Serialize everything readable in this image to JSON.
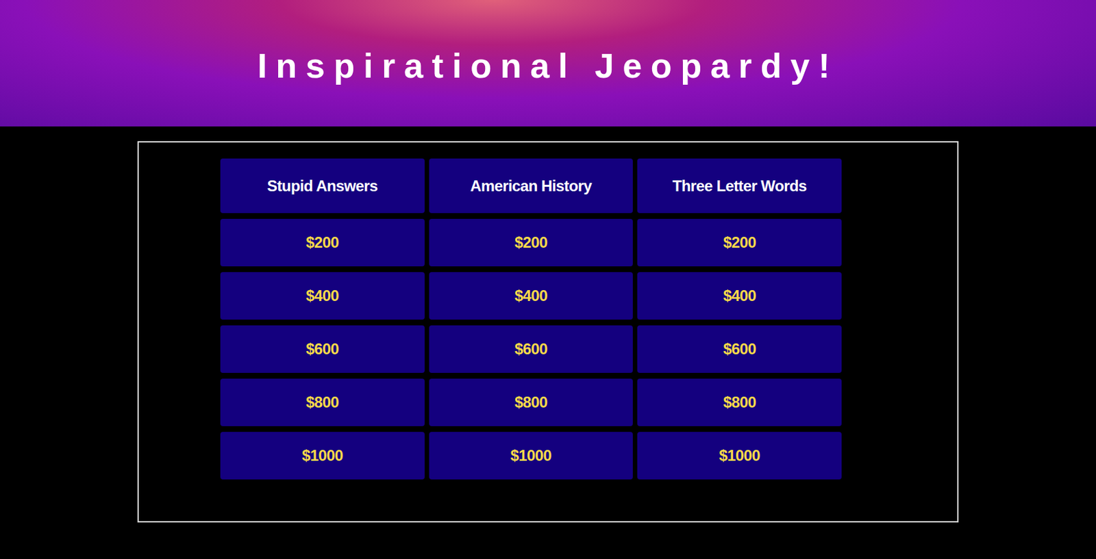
{
  "title": "Inspirational Jeopardy!",
  "categories": [
    {
      "name": "Stupid Answers",
      "values": [
        "$200",
        "$400",
        "$600",
        "$800",
        "$1000"
      ]
    },
    {
      "name": "American History",
      "values": [
        "$200",
        "$400",
        "$600",
        "$800",
        "$1000"
      ]
    },
    {
      "name": "Three Letter Words",
      "values": [
        "$200",
        "$400",
        "$600",
        "$800",
        "$1000"
      ]
    }
  ]
}
